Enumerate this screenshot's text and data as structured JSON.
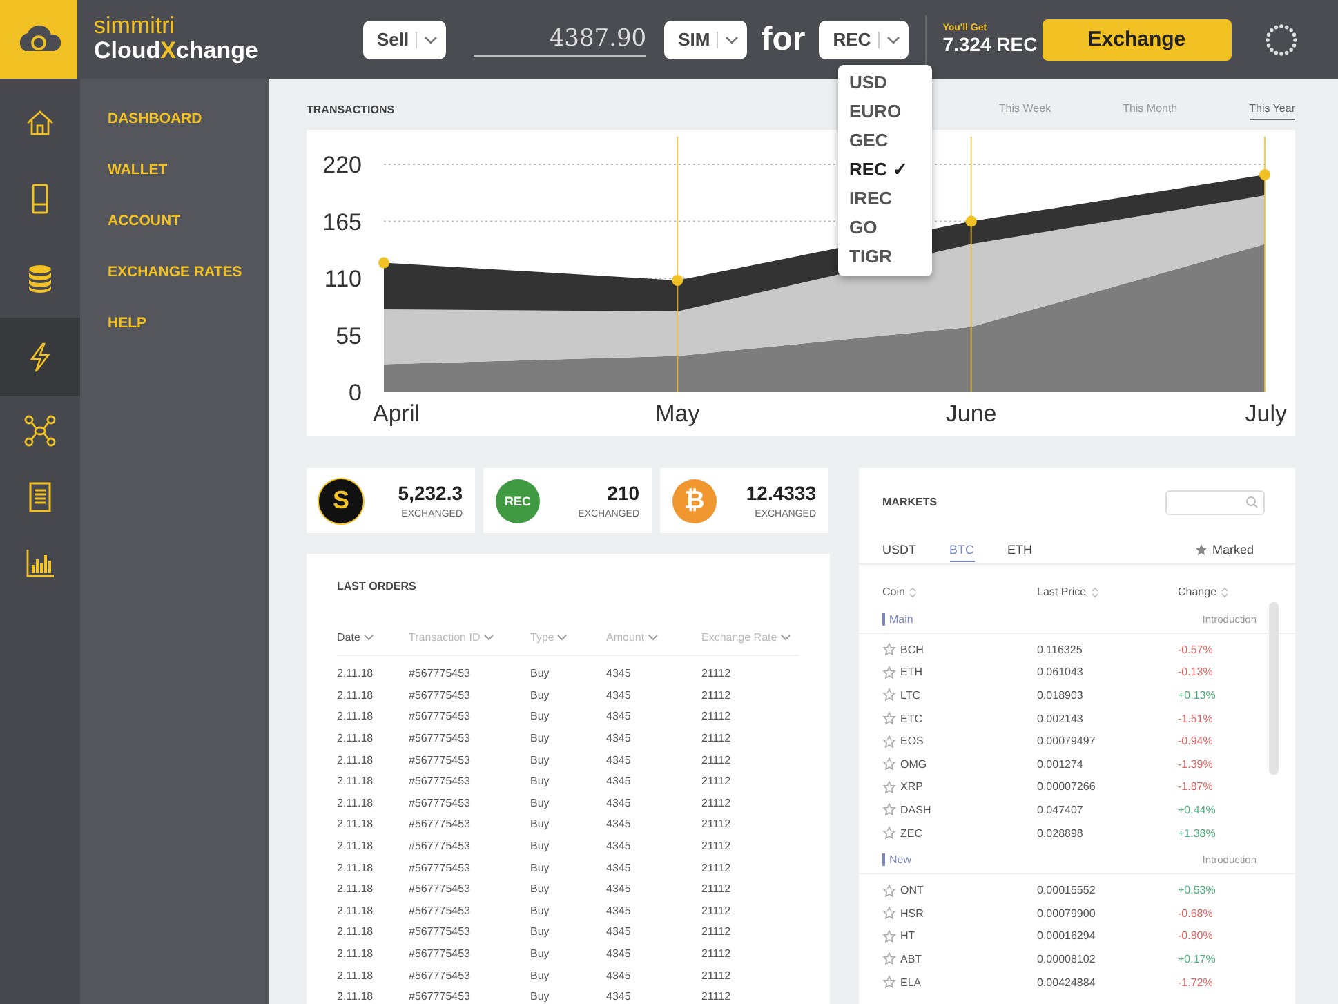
{
  "brand": {
    "subtitle": "simmitri",
    "title": "Cloud**X**change"
  },
  "exchange_bar": {
    "action": "Sell",
    "amount": "4387.90",
    "from_currency": "SIM",
    "joiner": "for",
    "to_currency": "REC",
    "result_label": "You'll Get",
    "result": "7.324 REC",
    "button": "Exchange"
  },
  "currency_menu": {
    "check_mark": "✓",
    "options": [
      {
        "label": "USD",
        "selected": false
      },
      {
        "label": "EURO",
        "selected": false
      },
      {
        "label": "GEC",
        "selected": false
      },
      {
        "label": "REC",
        "selected": true
      },
      {
        "label": "IREC",
        "selected": false
      },
      {
        "label": "GO",
        "selected": false
      },
      {
        "label": "TIGR",
        "selected": false
      }
    ]
  },
  "icon_bar": [
    {
      "selected": false
    },
    {
      "selected": false
    },
    {
      "selected": false
    },
    {
      "selected": true
    },
    {
      "selected": false
    },
    {
      "selected": false
    },
    {
      "selected": false
    }
  ],
  "sidebar": {
    "items": [
      "DASHBOARD",
      "WALLET",
      "ACCOUNT",
      "EXCHANGE RATES",
      "HELP"
    ]
  },
  "transactions": {
    "title": "TRANSACTIONS",
    "tabs": [
      {
        "label": "This Week",
        "selected": false
      },
      {
        "label": "This Month",
        "selected": false
      },
      {
        "label": "This Year",
        "selected": true
      }
    ],
    "chart_data": {
      "type": "area",
      "stacked": true,
      "grid": true,
      "categories": [
        "April",
        "May",
        "June",
        "July"
      ],
      "ylim": [
        0,
        220
      ],
      "yticks": [
        0,
        55,
        110,
        165,
        220
      ],
      "series": [
        {
          "color": "#7d7d7d",
          "values": [
            27,
            35,
            63,
            143
          ]
        },
        {
          "color": "#c9c9c9",
          "values": [
            53,
            43,
            80,
            47
          ]
        },
        {
          "color": "#333333",
          "values": [
            45,
            30,
            22,
            20
          ]
        }
      ]
    }
  },
  "stats": [
    {
      "symbol": "S",
      "color": "#111111",
      "value": "5,232.3",
      "label": "EXCHANGED"
    },
    {
      "symbol": "REC",
      "color": "#3f9a41",
      "value": "210",
      "label": "EXCHANGED"
    },
    {
      "symbol": "₿",
      "color": "#f0962e",
      "value": "12.4333",
      "label": "EXCHANGED"
    }
  ],
  "last_orders": {
    "title": "LAST ORDERS",
    "columns": [
      {
        "label": "Date",
        "selected": true
      },
      {
        "label": "Transaction ID",
        "selected": false
      },
      {
        "label": "Type",
        "selected": false
      },
      {
        "label": "Amount",
        "selected": false
      },
      {
        "label": "Exchange Rate",
        "selected": false
      }
    ],
    "rows": [
      [
        "2.11.18",
        "#567775453",
        "Buy",
        "4345",
        "21112"
      ],
      [
        "2.11.18",
        "#567775453",
        "Buy",
        "4345",
        "21112"
      ],
      [
        "2.11.18",
        "#567775453",
        "Buy",
        "4345",
        "21112"
      ],
      [
        "2.11.18",
        "#567775453",
        "Buy",
        "4345",
        "21112"
      ],
      [
        "2.11.18",
        "#567775453",
        "Buy",
        "4345",
        "21112"
      ],
      [
        "2.11.18",
        "#567775453",
        "Buy",
        "4345",
        "21112"
      ],
      [
        "2.11.18",
        "#567775453",
        "Buy",
        "4345",
        "21112"
      ],
      [
        "2.11.18",
        "#567775453",
        "Buy",
        "4345",
        "21112"
      ],
      [
        "2.11.18",
        "#567775453",
        "Buy",
        "4345",
        "21112"
      ],
      [
        "2.11.18",
        "#567775453",
        "Buy",
        "4345",
        "21112"
      ],
      [
        "2.11.18",
        "#567775453",
        "Buy",
        "4345",
        "21112"
      ],
      [
        "2.11.18",
        "#567775453",
        "Buy",
        "4345",
        "21112"
      ],
      [
        "2.11.18",
        "#567775453",
        "Buy",
        "4345",
        "21112"
      ],
      [
        "2.11.18",
        "#567775453",
        "Buy",
        "4345",
        "21112"
      ],
      [
        "2.11.18",
        "#567775453",
        "Buy",
        "4345",
        "21112"
      ],
      [
        "2.11.18",
        "#567775453",
        "Buy",
        "4345",
        "21112"
      ]
    ]
  },
  "markets": {
    "title": "MARKETS",
    "tabs": [
      {
        "label": "USDT",
        "selected": false
      },
      {
        "label": "BTC",
        "selected": true
      },
      {
        "label": "ETH",
        "selected": false
      }
    ],
    "marked": "Marked",
    "columns": [
      "Coin",
      "Last Price",
      "Change"
    ],
    "sections": [
      {
        "name": "Main",
        "note": "Introduction",
        "rows": [
          {
            "coin": "BCH",
            "price": "0.116325",
            "change": "-0.57%",
            "color": "#e0625f"
          },
          {
            "coin": "ETH",
            "price": "0.061043",
            "change": "-0.13%",
            "color": "#e0625f"
          },
          {
            "coin": "LTC",
            "price": "0.018903",
            "change": "+0.13%",
            "color": "#4cb07a"
          },
          {
            "coin": "ETC",
            "price": "0.002143",
            "change": "-1.51%",
            "color": "#e0625f"
          },
          {
            "coin": "EOS",
            "price": "0.00079497",
            "change": "-0.94%",
            "color": "#e0625f"
          },
          {
            "coin": "OMG",
            "price": "0.001274",
            "change": "-1.39%",
            "color": "#e0625f"
          },
          {
            "coin": "XRP",
            "price": "0.00007266",
            "change": "-1.87%",
            "color": "#e0625f"
          },
          {
            "coin": "DASH",
            "price": "0.047407",
            "change": "+0.44%",
            "color": "#4cb07a"
          },
          {
            "coin": "ZEC",
            "price": "0.028898",
            "change": "+1.38%",
            "color": "#4cb07a"
          }
        ]
      },
      {
        "name": "New",
        "note": "Introduction",
        "rows": [
          {
            "coin": "ONT",
            "price": "0.00015552",
            "change": "+0.53%",
            "color": "#4cb07a"
          },
          {
            "coin": "HSR",
            "price": "0.00079900",
            "change": "-0.68%",
            "color": "#e0625f"
          },
          {
            "coin": "HT",
            "price": "0.00016294",
            "change": "-0.80%",
            "color": "#e0625f"
          },
          {
            "coin": "ABT",
            "price": "0.00008102",
            "change": "+0.17%",
            "color": "#4cb07a"
          },
          {
            "coin": "ELA",
            "price": "0.00424884",
            "change": "-1.72%",
            "color": "#e0625f"
          }
        ]
      }
    ]
  }
}
